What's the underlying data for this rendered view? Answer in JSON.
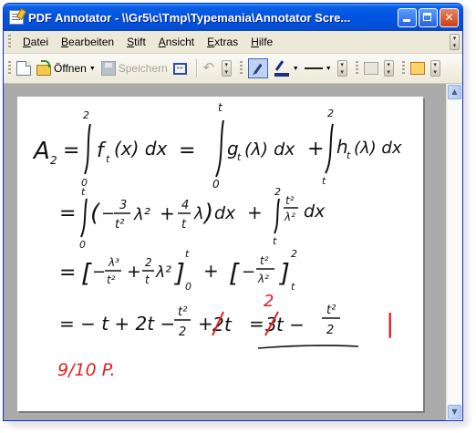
{
  "window": {
    "title": "PDF Annotator - \\\\Gr5\\c\\Tmp\\Typemania\\Annotator Scre..."
  },
  "menu": {
    "items": [
      {
        "key": "D",
        "rest": "atei"
      },
      {
        "key": "B",
        "rest": "earbeiten"
      },
      {
        "key": "S",
        "rest": "tift"
      },
      {
        "key": "A",
        "rest": "nsicht"
      },
      {
        "key": "E",
        "rest": "xtras"
      },
      {
        "key": "H",
        "rest": "ilfe"
      }
    ]
  },
  "toolbar": {
    "open_label": "Öffnen",
    "save_label": "Speichern"
  },
  "document": {
    "line1": {
      "lhs": "A",
      "lhs_sub": "2",
      "int1_upper": "2",
      "int1_lower": "0",
      "int1_body": "f",
      "int1_body_sub": "t",
      "int1_body_rest": "(x) dx",
      "int2_upper": "t",
      "int2_lower": "0",
      "int2_body": "g",
      "int2_body_sub": "t",
      "int2_body_rest": "(λ) dx",
      "int3_upper": "2",
      "int3_lower": "t",
      "int3_body": "h",
      "int3_body_sub": "t",
      "int3_body_rest": "(λ) dx"
    },
    "line2": {
      "upper1": "t",
      "lower1": "0",
      "num1": "3",
      "den1": "t²",
      "x1": "λ²",
      "num2": "4",
      "den2": "t",
      "x2": "λ",
      "dx1": "dx",
      "upper2": "2",
      "lower2": "t",
      "num3": "t²",
      "den3": "λ²",
      "dx2": "dx"
    },
    "line3": {
      "num1": "λ³",
      "den1": "t²",
      "num2": "2",
      "den2": "t",
      "x2": "λ²",
      "bound_upper1": "t",
      "bound_lower1": "0",
      "num3": "t²",
      "den3": "λ²",
      "bound_upper2": "2",
      "bound_lower2": "t"
    },
    "line4": {
      "start": "= − t + 2t −",
      "num1": "t²",
      "den1": "2",
      "plus": "+",
      "crossed_digit": "2",
      "crossed_tail": "t",
      "eq": "=",
      "crossed_digit2": "3",
      "tail2": "t −",
      "num2": "t²",
      "den2": "2"
    },
    "correction_red": "2",
    "red_mark": "|",
    "score": "9/10 P."
  },
  "colors": {
    "titlebar": "#0054e3",
    "ink": "#111111",
    "correction": "#e02020"
  },
  "icons": {
    "app": "pdf-annotator-icon",
    "new": "new-document-icon",
    "open": "open-folder-icon",
    "save": "save-disk-icon",
    "fit": "fit-width-icon",
    "undo": "undo-icon",
    "pen": "pen-icon",
    "color": "pen-color-icon",
    "line": "line-style-icon",
    "eraser": "eraser-icon",
    "highlighter": "highlighter-icon"
  }
}
